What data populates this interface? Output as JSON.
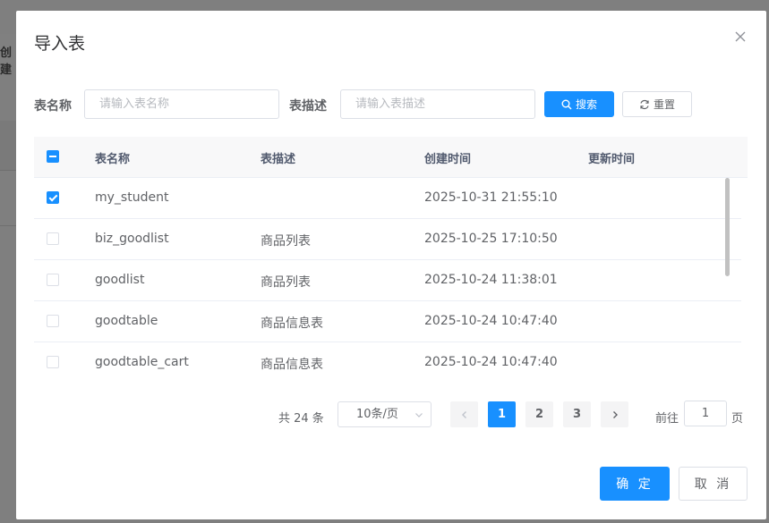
{
  "background": {
    "partial_text": "创建"
  },
  "dialog": {
    "title": "导入表"
  },
  "search": {
    "name_label": "表名称",
    "name_placeholder": "请输入表名称",
    "desc_label": "表描述",
    "desc_placeholder": "请输入表描述",
    "search_button": "搜索",
    "reset_button": "重置"
  },
  "table": {
    "columns": [
      "表名称",
      "表描述",
      "创建时间",
      "更新时间"
    ],
    "rows": [
      {
        "checked": true,
        "name": "my_student",
        "desc": "",
        "created": "2025-10-31 21:55:10",
        "updated": ""
      },
      {
        "checked": false,
        "name": "biz_goodlist",
        "desc": "商品列表",
        "created": "2025-10-25 17:10:50",
        "updated": ""
      },
      {
        "checked": false,
        "name": "goodlist",
        "desc": "商品列表",
        "created": "2025-10-24 11:38:01",
        "updated": ""
      },
      {
        "checked": false,
        "name": "goodtable",
        "desc": "商品信息表",
        "created": "2025-10-24 10:47:40",
        "updated": ""
      },
      {
        "checked": false,
        "name": "goodtable_cart",
        "desc": "商品信息表",
        "created": "2025-10-24 10:47:40",
        "updated": ""
      }
    ]
  },
  "pagination": {
    "total": "共 24 条",
    "page_size": "10条/页",
    "pages": [
      "1",
      "2",
      "3"
    ],
    "current_page": "1",
    "goto_label": "前往",
    "goto_value": "1",
    "page_unit": "页"
  },
  "footer": {
    "ok": "确 定",
    "cancel": "取 消"
  },
  "colors": {
    "primary": "#1890ff",
    "border": "#dcdfe6",
    "header_bg": "#f8f8f9"
  }
}
